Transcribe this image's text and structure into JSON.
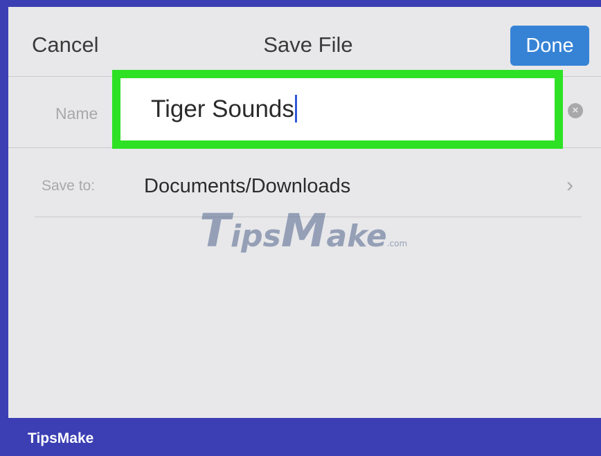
{
  "navbar": {
    "cancel_label": "Cancel",
    "title": "Save File",
    "done_label": "Done"
  },
  "form": {
    "name_label": "Name",
    "name_value": "Tiger Sounds",
    "save_to_label": "Save to:",
    "save_to_value": "Documents/Downloads"
  },
  "icons": {
    "clear": "clear-circle-icon",
    "chevron": "chevron-right-icon",
    "clear_glyph": "×",
    "chevron_glyph": "›"
  },
  "watermark": {
    "t": "T",
    "ips": "ips",
    "m": "M",
    "ake": "ake",
    "com": ".com"
  },
  "footer": {
    "brand": "TipsMake"
  },
  "colors": {
    "frame": "#3b3fb3",
    "highlight": "#2ee125",
    "done_button": "#3683d6",
    "background": "#e8e8ea"
  }
}
